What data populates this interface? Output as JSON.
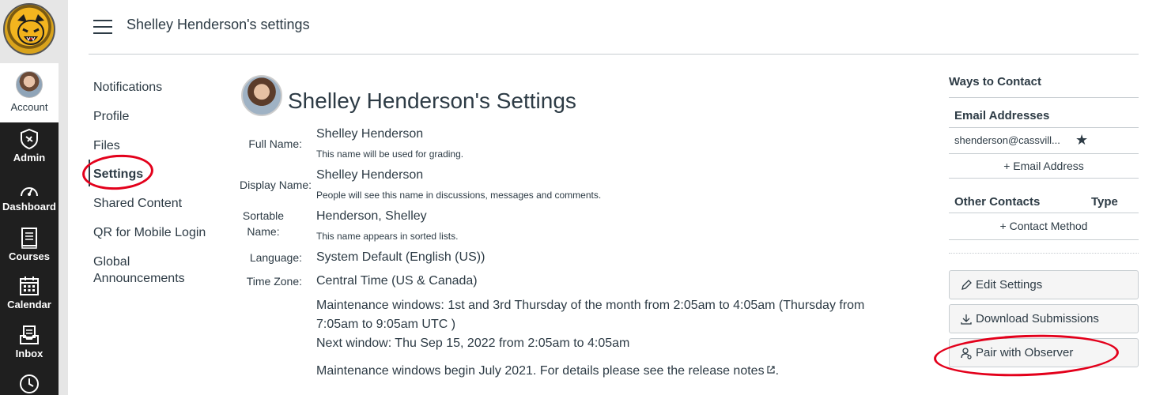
{
  "global_nav": {
    "account": "Account",
    "admin": "Admin",
    "dashboard": "Dashboard",
    "courses": "Courses",
    "calendar": "Calendar",
    "inbox": "Inbox"
  },
  "header": {
    "title": "Shelley Henderson's settings"
  },
  "left_menu": {
    "items": [
      {
        "label": "Notifications"
      },
      {
        "label": "Profile"
      },
      {
        "label": "Files"
      },
      {
        "label": "Settings"
      },
      {
        "label": "Shared Content"
      },
      {
        "label": "QR for Mobile Login"
      },
      {
        "label": "Global Announcements"
      }
    ],
    "active": "Settings"
  },
  "main": {
    "title": "Shelley Henderson's Settings",
    "fields": {
      "full_name": {
        "label": "Full Name:",
        "value": "Shelley Henderson",
        "hint": "This name will be used for grading."
      },
      "display_name": {
        "label": "Display Name:",
        "value": "Shelley Henderson",
        "hint": "People will see this name in discussions, messages and comments."
      },
      "sortable_name": {
        "label": "Sortable Name:",
        "value": "Henderson, Shelley",
        "hint": "This name appears in sorted lists."
      },
      "language": {
        "label": "Language:",
        "value": "System Default (English (US))"
      },
      "time_zone": {
        "label": "Time Zone:",
        "value": "Central Time (US & Canada)"
      }
    },
    "maintenance": {
      "windows": "Maintenance windows: 1st and 3rd Thursday of the month from 2:05am to 4:05am (Thursday from 7:05am to 9:05am UTC )",
      "next": "Next window: Thu Sep 15, 2022 from 2:05am to 4:05am",
      "begin": "Maintenance windows begin July 2021. For details please see the release notes",
      "end": "."
    }
  },
  "sidebar": {
    "ways_to_contact": "Ways to Contact",
    "email_addresses": "Email Addresses",
    "email": "shenderson@cassvill...",
    "add_email": "Email Address",
    "other_contacts": "Other Contacts",
    "type": "Type",
    "add_contact": "Contact Method",
    "buttons": {
      "edit": "Edit Settings",
      "download": "Download Submissions",
      "pair": "Pair with Observer"
    }
  },
  "colors": {
    "nav_bg": "#1f1f1f",
    "text": "#2d3b45",
    "annotation": "#e3001b"
  }
}
